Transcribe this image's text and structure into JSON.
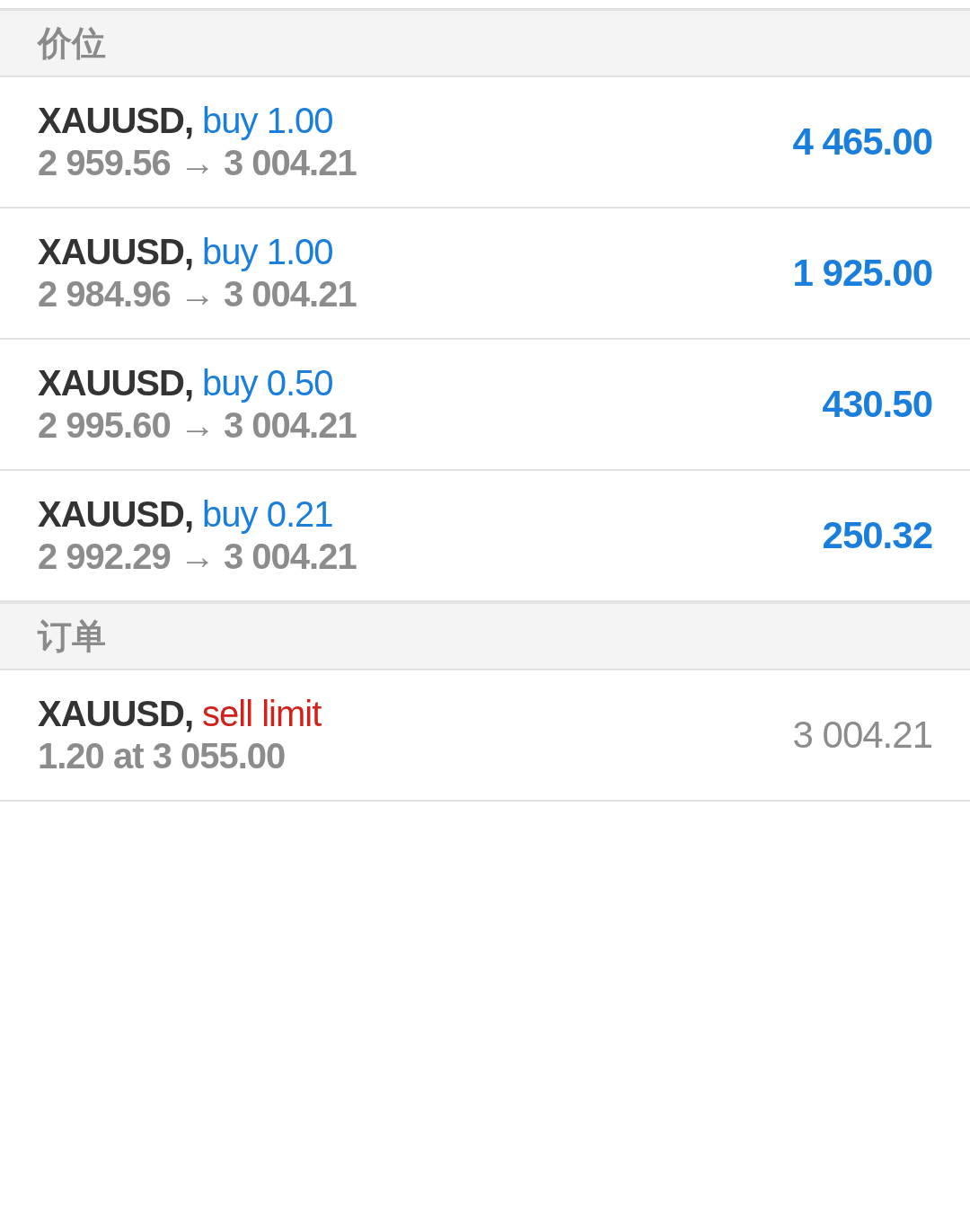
{
  "sections": [
    {
      "title": "价位",
      "rows": [
        {
          "symbol": "XAUUSD,",
          "action": {
            "kind": "buy",
            "text": "buy 1.00"
          },
          "detail": "2 959.56 → 3 004.21",
          "value": {
            "kind": "profit",
            "text": "4 465.00"
          }
        },
        {
          "symbol": "XAUUSD,",
          "action": {
            "kind": "buy",
            "text": "buy 1.00"
          },
          "detail": "2 984.96 → 3 004.21",
          "value": {
            "kind": "profit",
            "text": "1 925.00"
          }
        },
        {
          "symbol": "XAUUSD,",
          "action": {
            "kind": "buy",
            "text": "buy 0.50"
          },
          "detail": "2 995.60 → 3 004.21",
          "value": {
            "kind": "profit",
            "text": "430.50"
          }
        },
        {
          "symbol": "XAUUSD,",
          "action": {
            "kind": "buy",
            "text": "buy 0.21"
          },
          "detail": "2 992.29 → 3 004.21",
          "value": {
            "kind": "profit",
            "text": "250.32"
          }
        }
      ]
    },
    {
      "title": "订单",
      "rows": [
        {
          "symbol": "XAUUSD,",
          "action": {
            "kind": "sell",
            "text": "sell limit"
          },
          "detail": "1.20 at 3 055.00",
          "value": {
            "kind": "price",
            "text": "3 004.21"
          }
        }
      ]
    }
  ]
}
